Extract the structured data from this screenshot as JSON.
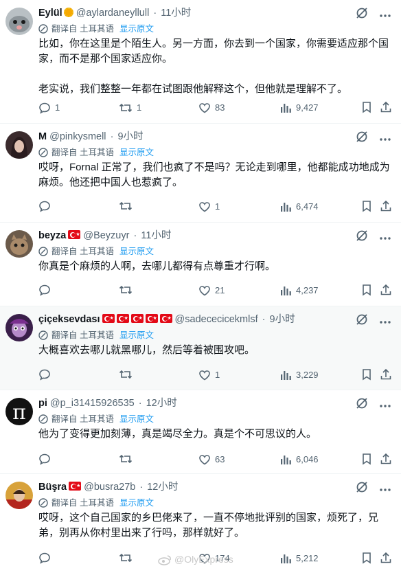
{
  "translate_label": "翻译自 土耳其语",
  "show_original": "显示原文",
  "watermark": "@OlyExpress",
  "tweets": [
    {
      "name": "Eylül",
      "handle": "@aylardaneyllull",
      "sep": "·",
      "time": "11小时",
      "text": "比如，你在这里是个陌生人。另一方面，你去到一个国家，你需要适应那个国家，而不是那个国家适应你。\n\n老实说，我们整整一年都在试图跟他解释这个，但他就是理解不了。",
      "reply": "1",
      "retweet": "1",
      "like": "83",
      "views": "9,427",
      "avatar_color": "#9aa3a8"
    },
    {
      "name": "M",
      "handle": "@pinkysmell",
      "sep": "·",
      "time": "9小时",
      "text": "哎呀，Fornal 正常了，我们也疯了不是吗？无论走到哪里，他都能成功地成为麻烦。他还把中国人也惹疯了。",
      "reply": "",
      "retweet": "",
      "like": "1",
      "views": "6,474",
      "avatar_color": "#4b3a3a"
    },
    {
      "name": "beyza",
      "handle": "@Beyzuyr",
      "sep": "·",
      "time": "11小时",
      "text": "你真是个麻烦的人啊，去哪儿都得有点尊重才行啊。",
      "reply": "",
      "retweet": "",
      "like": "21",
      "views": "4,237",
      "avatar_color": "#8a6a4e"
    },
    {
      "name": "çiçeksevdası",
      "handle": "@sadececicekmlsf",
      "sep": "·",
      "time": "9小时",
      "text": "大概喜欢去哪儿就黑哪儿，然后等着被围攻吧。",
      "reply": "",
      "retweet": "",
      "like": "1",
      "views": "3,229",
      "avatar_color": "#6a3b7a"
    },
    {
      "name": "pi",
      "handle": "@p_i31415926535",
      "sep": "·",
      "time": "12小时",
      "text": "他为了变得更加刻薄，真是竭尽全力。真是个不可思议的人。",
      "reply": "",
      "retweet": "",
      "like": "63",
      "views": "6,046",
      "avatar_color": "#111111"
    },
    {
      "name": "Büşra",
      "handle": "@busra27b",
      "sep": "·",
      "time": "12小时",
      "text": "哎呀，这个自己国家的乡巴佬来了，一直不停地批评别的国家，烦死了，兄弟，别再从你村里出来了行吗，那样就好了。",
      "reply": "",
      "retweet": "",
      "like": "174",
      "views": "5,212",
      "avatar_color": "#c99a2e"
    }
  ]
}
